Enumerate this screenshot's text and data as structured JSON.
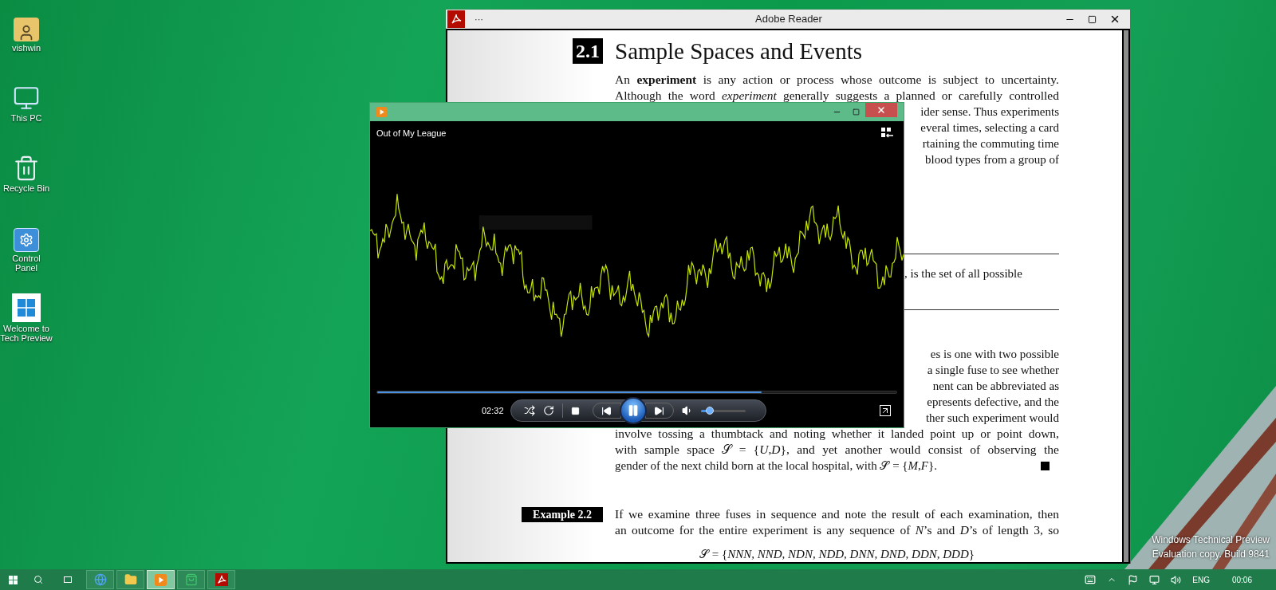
{
  "desktop_icons": [
    {
      "label": "vishwin",
      "kind": "user"
    },
    {
      "label": "This PC",
      "kind": "pc"
    },
    {
      "label": "Recycle Bin",
      "kind": "bin"
    },
    {
      "label": "Control Panel",
      "kind": "control"
    },
    {
      "label": "Welcome to Tech Preview",
      "kind": "welcome"
    }
  ],
  "reader": {
    "title": "Adobe Reader",
    "menu": "···",
    "section_number": "2.1",
    "section_title": "Sample Spaces and Events",
    "paragraph_1": {
      "lines": [
        "An **experiment** is any action or process whose outcome is subject to uncertainty.",
        "Although the word *experiment* generally suggests a planned or carefully controlled"
      ],
      "partial_lines": [
        "ider sense. Thus experiments",
        "everal times, selecting a card",
        "rtaining the commuting time",
        "blood types from a group of"
      ]
    },
    "definition_fragment": ", is the set of all possible",
    "paragraph_2": {
      "partial_lines": [
        "es is one with two possible",
        "a single fuse to see whether",
        "nent can be abbreviated as",
        "epresents defective, and the",
        "ther such experiment would"
      ],
      "lines": [
        "involve tossing a thumbtack and noting whether it landed point up or point down,",
        "with sample space 𝒮 = {*U*,*D*}, and yet another would consist of observing the"
      ],
      "last_line": "gender of the next child born at the local hospital, with 𝒮 = {*M*,*F*}."
    },
    "example": {
      "label": "Example 2.2",
      "lines": [
        "If we examine three fuses in sequence and note the result of each examination, then",
        "an outcome for the entire experiment is any sequence of *N*’s and *D*’s of length 3, so"
      ],
      "formula": "𝒮 = {*NNN*, *NND*, *NDN*, *NDD*, *DNN*, *DND*, *DDN*, *DDD*}"
    }
  },
  "player": {
    "track_title": "Out of My League",
    "seek": {
      "level": 0.74
    },
    "time": "02:32",
    "playing": true,
    "volume": {
      "level": 0.2
    }
  },
  "watermark": [
    "Windows Technical Preview",
    "Evaluation copy. Build 9841"
  ],
  "taskbar": {
    "apps": [
      {
        "kind": "browser",
        "selected": false
      },
      {
        "kind": "folder",
        "selected": false
      },
      {
        "kind": "media",
        "selected": true
      },
      {
        "kind": "store",
        "selected": false
      },
      {
        "kind": "reader",
        "selected": false
      }
    ],
    "language": "ENG",
    "clock": "00:06"
  }
}
